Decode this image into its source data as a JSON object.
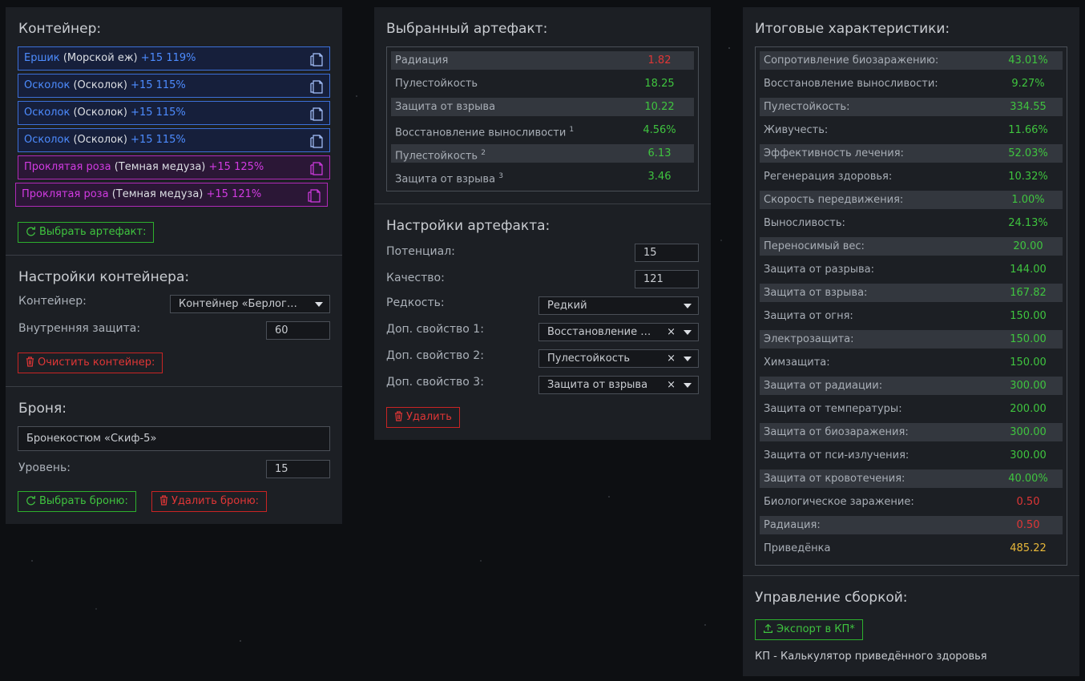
{
  "colors": {
    "green": "#3fc43f",
    "red": "#e03636",
    "yellow": "#e8b83a",
    "blue": "#4d8cff",
    "purple": "#d23be2"
  },
  "left": {
    "container_title": "Контейнер:",
    "artifacts": [
      {
        "name": "Ершик",
        "sub": "(Морской еж)",
        "level": "+15 119%",
        "color": "blue",
        "icon": "copy-icon"
      },
      {
        "name": "Осколок",
        "sub": "(Осколок)",
        "level": "+15 115%",
        "color": "blue",
        "icon": "copy-icon"
      },
      {
        "name": "Осколок",
        "sub": "(Осколок)",
        "level": "+15 115%",
        "color": "blue",
        "icon": "copy-icon"
      },
      {
        "name": "Осколок",
        "sub": "(Осколок)",
        "level": "+15 115%",
        "color": "blue",
        "icon": "copy-icon"
      },
      {
        "name": "Проклятая роза",
        "sub": "(Темная медуза)",
        "level": "+15 125%",
        "color": "purple",
        "icon": "copy-icon"
      },
      {
        "name": "Проклятая роза",
        "sub": "(Темная медуза)",
        "level": "+15 121%",
        "color": "purple",
        "icon": "copy-icon"
      }
    ],
    "select_artifact_btn": "Выбрать артефакт:",
    "container_settings_title": "Настройки контейнера:",
    "container_label": "Контейнер:",
    "container_value": "Контейнер «Берлога...",
    "inner_protection_label": "Внутренняя защита:",
    "inner_protection_value": "60",
    "clear_container_btn": "Очистить контейнер:",
    "armor_title": "Броня:",
    "armor_value": "Бронекостюм «Скиф-5»",
    "level_label": "Уровень:",
    "level_value": "15",
    "select_armor_btn": "Выбрать броню:",
    "delete_armor_btn": "Удалить броню:"
  },
  "middle": {
    "selected_title": "Выбранный артефакт:",
    "stats": [
      {
        "k": "Радиация",
        "sup": "",
        "v": "1.82",
        "c": "r"
      },
      {
        "k": "Пулестойкость",
        "sup": "",
        "v": "18.25",
        "c": "g"
      },
      {
        "k": "Защита от взрыва",
        "sup": "",
        "v": "10.22",
        "c": "g"
      },
      {
        "k": "Восстановление выносливости",
        "sup": "1",
        "v": "4.56%",
        "c": "g"
      },
      {
        "k": "Пулестойкость",
        "sup": "2",
        "v": "6.13",
        "c": "g"
      },
      {
        "k": "Защита от взрыва",
        "sup": "3",
        "v": "3.46",
        "c": "g"
      }
    ],
    "settings_title": "Настройки артефакта:",
    "potential_label": "Потенциал:",
    "potential_value": "15",
    "quality_label": "Качество:",
    "quality_value": "121",
    "rarity_label": "Редкость:",
    "rarity_value": "Редкий",
    "prop1_label": "Доп. свойство 1:",
    "prop1_value": "Восстановление в...",
    "prop2_label": "Доп. свойство 2:",
    "prop2_value": "Пулестойкость",
    "prop3_label": "Доп. свойство 3:",
    "prop3_value": "Защита от взрыва",
    "clear_symbol": "×",
    "delete_btn": "Удалить"
  },
  "right": {
    "totals_title": "Итоговые характеристики:",
    "stats": [
      {
        "k": "Сопротивление биозаражению:",
        "v": "43.01%",
        "c": "g"
      },
      {
        "k": "Восстановление выносливости:",
        "v": "9.27%",
        "c": "g"
      },
      {
        "k": "Пулестойкость:",
        "v": "334.55",
        "c": "g"
      },
      {
        "k": "Живучесть:",
        "v": "11.66%",
        "c": "g"
      },
      {
        "k": "Эффективность лечения:",
        "v": "52.03%",
        "c": "g"
      },
      {
        "k": "Регенерация здоровья:",
        "v": "10.32%",
        "c": "g"
      },
      {
        "k": "Скорость передвижения:",
        "v": "1.00%",
        "c": "g"
      },
      {
        "k": "Выносливость:",
        "v": "24.13%",
        "c": "g"
      },
      {
        "k": "Переносимый вес:",
        "v": "20.00",
        "c": "g"
      },
      {
        "k": "Защита от разрыва:",
        "v": "144.00",
        "c": "g"
      },
      {
        "k": "Защита от взрыва:",
        "v": "167.82",
        "c": "g"
      },
      {
        "k": "Защита от огня:",
        "v": "150.00",
        "c": "g"
      },
      {
        "k": "Электрозащита:",
        "v": "150.00",
        "c": "g"
      },
      {
        "k": "Химзащита:",
        "v": "150.00",
        "c": "g"
      },
      {
        "k": "Защита от радиации:",
        "v": "300.00",
        "c": "g"
      },
      {
        "k": "Защита от температуры:",
        "v": "200.00",
        "c": "g"
      },
      {
        "k": "Защита от биозаражения:",
        "v": "300.00",
        "c": "g"
      },
      {
        "k": "Защита от пси-излучения:",
        "v": "300.00",
        "c": "g"
      },
      {
        "k": "Защита от кровотечения:",
        "v": "40.00%",
        "c": "g"
      },
      {
        "k": "Биологическое заражение:",
        "v": "0.50",
        "c": "r"
      },
      {
        "k": "Радиация:",
        "v": "0.50",
        "c": "r"
      },
      {
        "k": "Приведёнка",
        "v": "485.22",
        "c": "y"
      }
    ],
    "build_title": "Управление сборкой:",
    "export_btn": "Экспорт в КП*",
    "footnote": "КП - Калькулятор приведённого здоровья"
  }
}
